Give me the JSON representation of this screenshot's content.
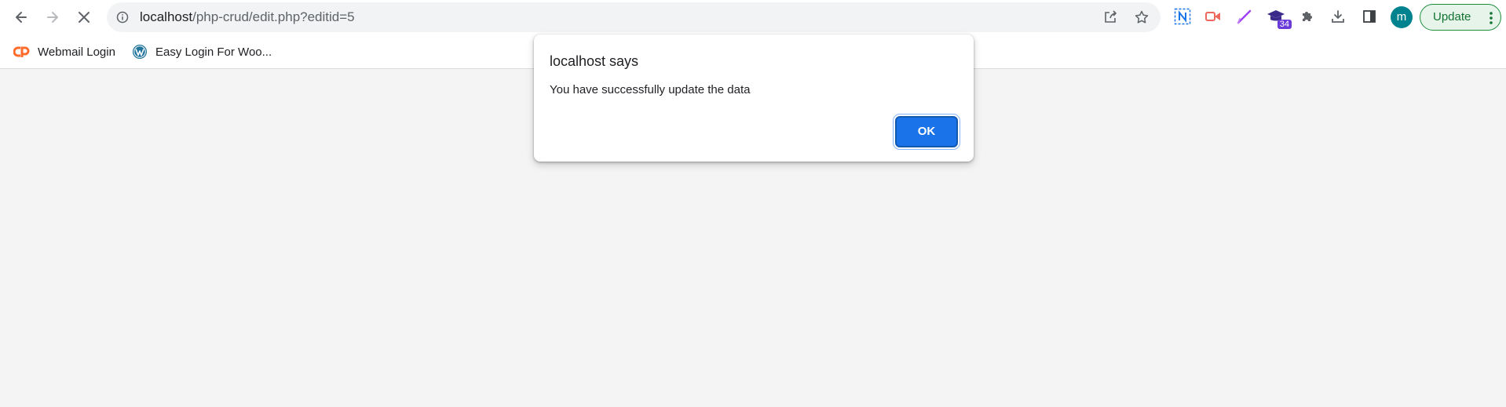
{
  "browser": {
    "url_host": "localhost",
    "url_path": "/php-crud/edit.php?editid=5",
    "update_label": "Update",
    "profile_initial": "m",
    "extension_badge": "34"
  },
  "bookmarks": [
    {
      "label": "Webmail Login",
      "icon": "cpanel-icon"
    },
    {
      "label": "Easy Login For Woo...",
      "icon": "wordpress-icon"
    }
  ],
  "dialog": {
    "title": "localhost says",
    "message": "You have successfully update the data",
    "ok_label": "OK"
  },
  "colors": {
    "accent": "#1a73e8",
    "update_green": "#137333",
    "avatar": "#00838f",
    "page_bg": "#f4f4f4"
  }
}
